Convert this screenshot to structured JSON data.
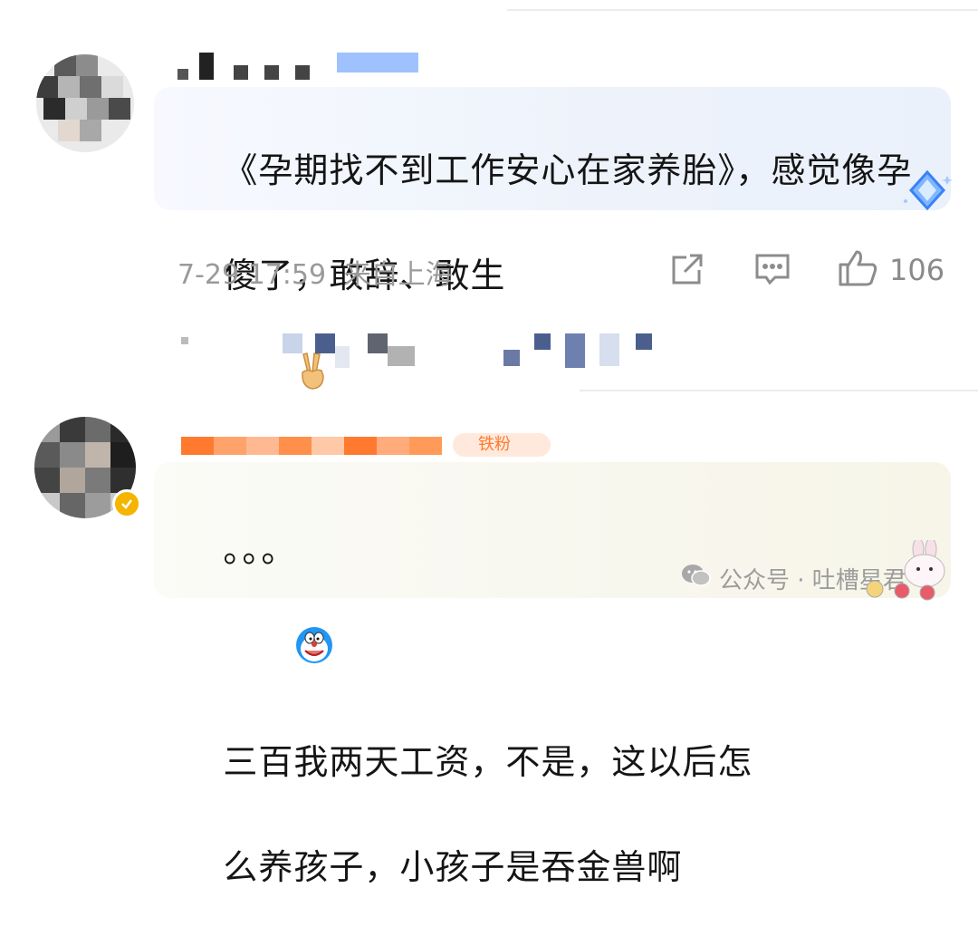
{
  "comments": [
    {
      "text_line1": "《孕期找不到工作安心在家养胎》，感觉像孕",
      "text_line2": "傻了，敢辞、敢生",
      "emoji": "victory-hand-emoji",
      "timestamp": "7-29 17:59",
      "location": "来自上海",
      "likes": "106"
    },
    {
      "prefix": "。。。",
      "emoji": "doraemon-emoji",
      "text_line1": "三百我两天工资，不是，这以后怎",
      "text_line2": "么养孩子，小孩子是吞金兽啊",
      "badge": "铁粉"
    }
  ],
  "watermark": {
    "label": "公众号 · 吐槽星君"
  },
  "colors": {
    "bubble": "#eef3fb",
    "meta_text": "#9a9a9a",
    "badge_blue": "#2f7cf6",
    "verified_yellow": "#f5b400",
    "name_orange": "#ff8a3d"
  }
}
